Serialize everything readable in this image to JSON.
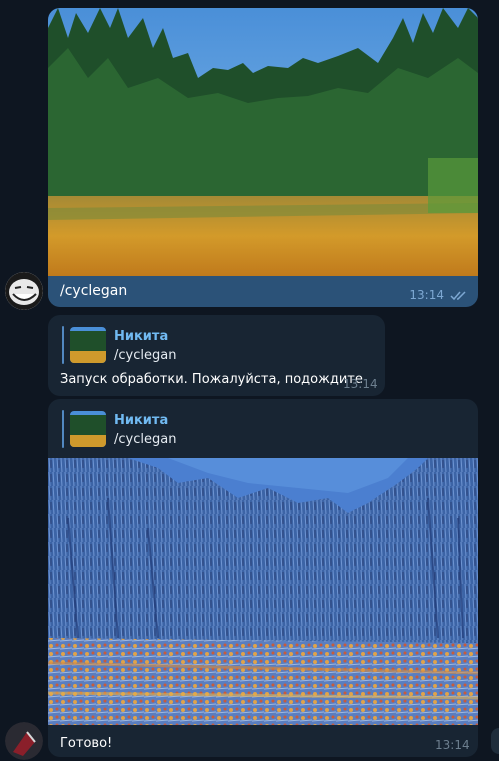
{
  "messages": {
    "outgoing": {
      "text": "/cyclegan",
      "time": "13:14",
      "photo_icon": "forest-meadow-photo"
    },
    "bot_reply_1": {
      "reply_name": "Никита",
      "reply_text": "/cyclegan",
      "text": "Запуск обработки. Пожалуйста, подождите",
      "time": "13:14"
    },
    "bot_reply_2": {
      "reply_name": "Никита",
      "reply_text": "/cyclegan",
      "text": "Готово!",
      "time": "13:14",
      "photo_icon": "stylized-forest-photo"
    }
  },
  "colors": {
    "background": "#0e1621",
    "outgoing_bubble": "#2b5278",
    "incoming_bubble": "#182533",
    "accent": "#71baf2"
  }
}
